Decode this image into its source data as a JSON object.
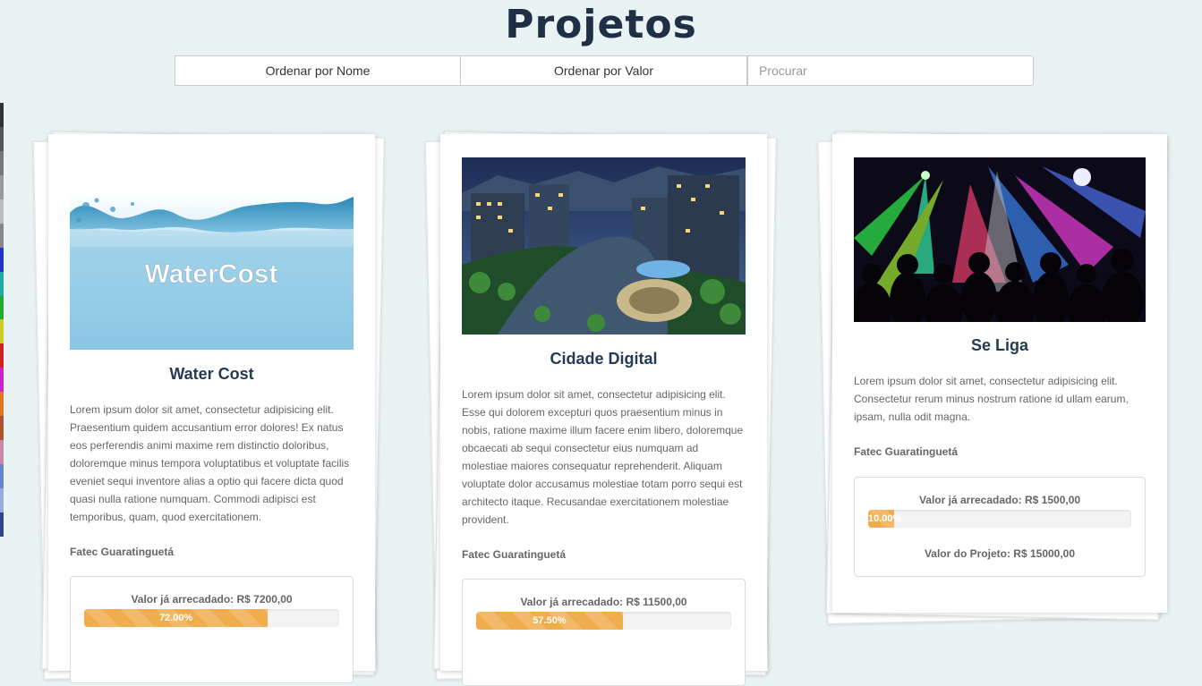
{
  "page": {
    "title": "Projetos"
  },
  "toolbar": {
    "sort_by_name_label": "Ordenar por Nome",
    "sort_by_value_label": "Ordenar por Valor",
    "search_placeholder": "Procurar"
  },
  "colors": {
    "background": "#e9f3f3",
    "title": "#1f2f45",
    "card_title": "#243b55",
    "progress": "#f0ad4e"
  },
  "projects": [
    {
      "image_text": "WaterCost",
      "image_icon": "water-splash-image",
      "title": "Water Cost",
      "description": "Lorem ipsum dolor sit amet, consectetur adipisicing elit. Praesentium quidem accusantium error dolores! Ex natus eos perferendis animi maxime rem distinctio doloribus, doloremque minus tempora voluptatibus et voluptate facilis eveniet sequi inventore alias a optio qui facere dicta quod quasi nulla ratione numquam. Commodi adipisci est temporibus, quam, quod exercitationem.",
      "organization": "Fatec Guaratinguetá",
      "raised_label": "Valor já arrecadado: R$ 7200,00",
      "progress_label": "72.00%",
      "progress_fraction": 0.72
    },
    {
      "image_icon": "night-city-image",
      "title": "Cidade Digital",
      "description": "Lorem ipsum dolor sit amet, consectetur adipisicing elit. Esse qui dolorem excepturi quos praesentium minus in nobis, ratione maxime illum facere enim libero, doloremque obcaecati ab sequi consectetur eius numquam ad molestiae maiores consequatur reprehenderit. Aliquam voluptate dolor accusamus molestiae totam porro sequi est architecto itaque. Recusandae exercitationem molestiae provident.",
      "organization": "Fatec Guaratinguetá",
      "raised_label": "Valor já arrecadado: R$ 11500,00",
      "progress_label": "57.50%",
      "progress_fraction": 0.575
    },
    {
      "image_icon": "concert-lights-image",
      "title": "Se Liga",
      "description": "Lorem ipsum dolor sit amet, consectetur adipisicing elit. Consectetur rerum minus nostrum ratione id ullam earum, ipsam, nulla odit magna.",
      "organization": "Fatec Guaratinguetá",
      "raised_label": "Valor já arrecadado: R$ 1500,00",
      "progress_label": "10.00%",
      "progress_fraction": 0.1,
      "goal_label": "Valor do Projeto: R$ 15000,00"
    }
  ]
}
